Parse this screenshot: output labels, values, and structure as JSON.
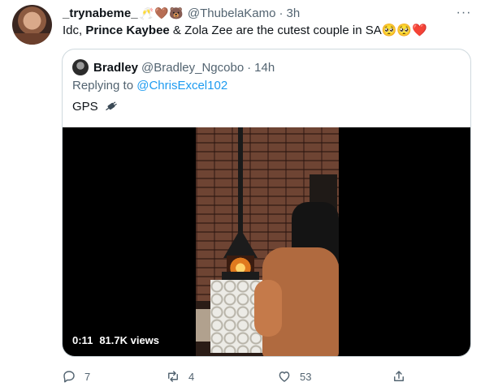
{
  "tweet": {
    "display_name": "_trynabeme_",
    "name_emojis": "🥂🤎🐻",
    "handle": "@ThubelaKamo",
    "separator": "·",
    "time": "3h",
    "text_before": "Idc, ",
    "text_bold": "Prince Kaybee",
    "text_after": " & Zola Zee are the cutest couple in SA",
    "emoji_face": "🥺",
    "emoji_heart": "❤️",
    "more_icon": "···"
  },
  "quoted": {
    "display_name": "Bradley",
    "handle": "@Bradley_Ngcobo",
    "separator": "·",
    "time": "14h",
    "reply_prefix": "Replying to ",
    "reply_mention": "@ChrisExcel102",
    "text": "GPS",
    "text_icon": "plug-icon"
  },
  "video": {
    "duration": "0:11",
    "views": "81.7K views"
  },
  "actions": {
    "reply_count": "7",
    "retweet_count": "4",
    "like_count": "53"
  },
  "colors": {
    "text_primary": "#0f1419",
    "text_secondary": "#536471",
    "link": "#1d9bf0",
    "border": "#cfd9de"
  }
}
